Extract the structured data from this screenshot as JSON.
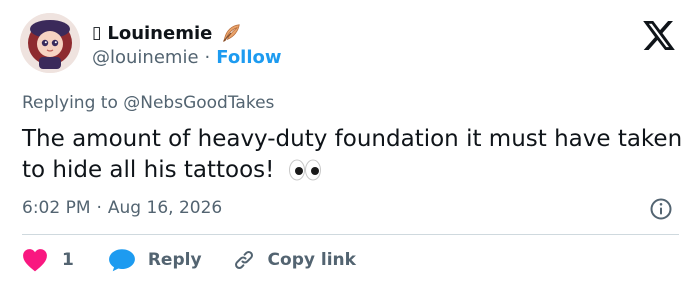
{
  "author": {
    "name_glyph": "▯",
    "display_name": "Louinemie",
    "handle": "@louinemie",
    "separator": "·",
    "follow_label": "Follow"
  },
  "brand": {
    "logo_icon": "x-logo-icon",
    "accent_color": "#1d9bf0"
  },
  "reply": {
    "prefix": "Replying to",
    "mention": "@NebsGoodTakes"
  },
  "tweet": {
    "text": "The amount of heavy-duty foundation it must have taken to hide all his tattoos!",
    "emoji_icon": "eyes-emoji-icon"
  },
  "meta": {
    "time": "6:02 PM",
    "separator": "·",
    "date": "Aug 16, 2026"
  },
  "actions": {
    "like_count": "1",
    "reply_label": "Reply",
    "copy_link_label": "Copy link",
    "heart_color": "#f91880",
    "reply_color": "#1d9bf0"
  }
}
